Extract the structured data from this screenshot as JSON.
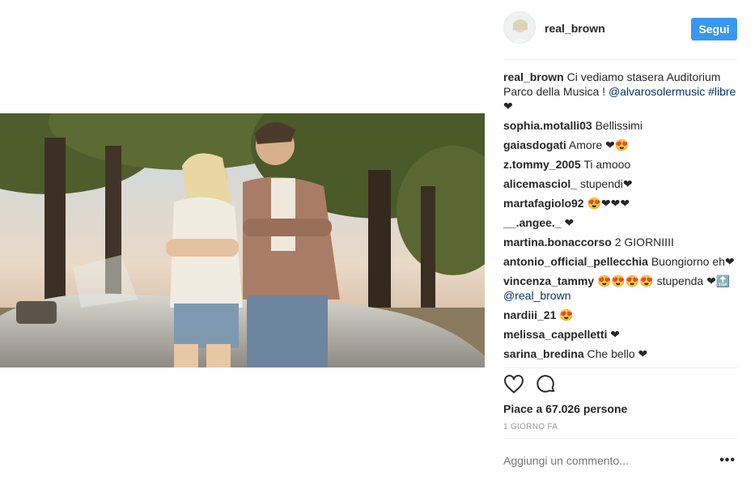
{
  "post": {
    "username": "real_brown",
    "follow_label": "Segui",
    "caption": {
      "user": "real_brown",
      "text_before": "Ci vediamo stasera Auditorium Parco della Musica !",
      "mention": "@alvarosolermusic",
      "hashtag": "#libre",
      "emoji": "❤"
    },
    "comments": [
      {
        "user": "sophia.motalli03",
        "text": "Bellissimi"
      },
      {
        "user": "gaiasdogati",
        "text": "Amore ❤😍"
      },
      {
        "user": "z.tommy_2005",
        "text": "Ti amooo"
      },
      {
        "user": "alicemasciol_",
        "text": "stupendi❤"
      },
      {
        "user": "martafagiolo92",
        "text": "😍❤❤❤"
      },
      {
        "user": "__.angee._",
        "text": "❤"
      },
      {
        "user": "martina.bonaccorso",
        "text": "2 GIORNIIII"
      },
      {
        "user": "antonio_official_pellecchia",
        "text": "Buongiorno eh❤"
      },
      {
        "user": "vincenza_tammy",
        "text": "😍😍😍😍 stupenda ❤🔝",
        "mention": "@real_brown"
      },
      {
        "user": "nardiii_21",
        "text": "😍"
      },
      {
        "user": "melissa_cappelletti",
        "text": "❤"
      },
      {
        "user": "sarina_bredina",
        "text": "Che bello ❤"
      }
    ],
    "likes_text": "Piace a 67.026 persone",
    "time_text": "1 GIORNO FA",
    "comment_placeholder": "Aggiungi un commento...",
    "more_label": "•••",
    "icons": {
      "like": "heart-outline-icon",
      "comment": "speech-bubble-icon",
      "more": "ellipsis-icon"
    },
    "colors": {
      "follow_bg": "#3897f0",
      "link": "#003569",
      "muted": "#999999"
    }
  }
}
